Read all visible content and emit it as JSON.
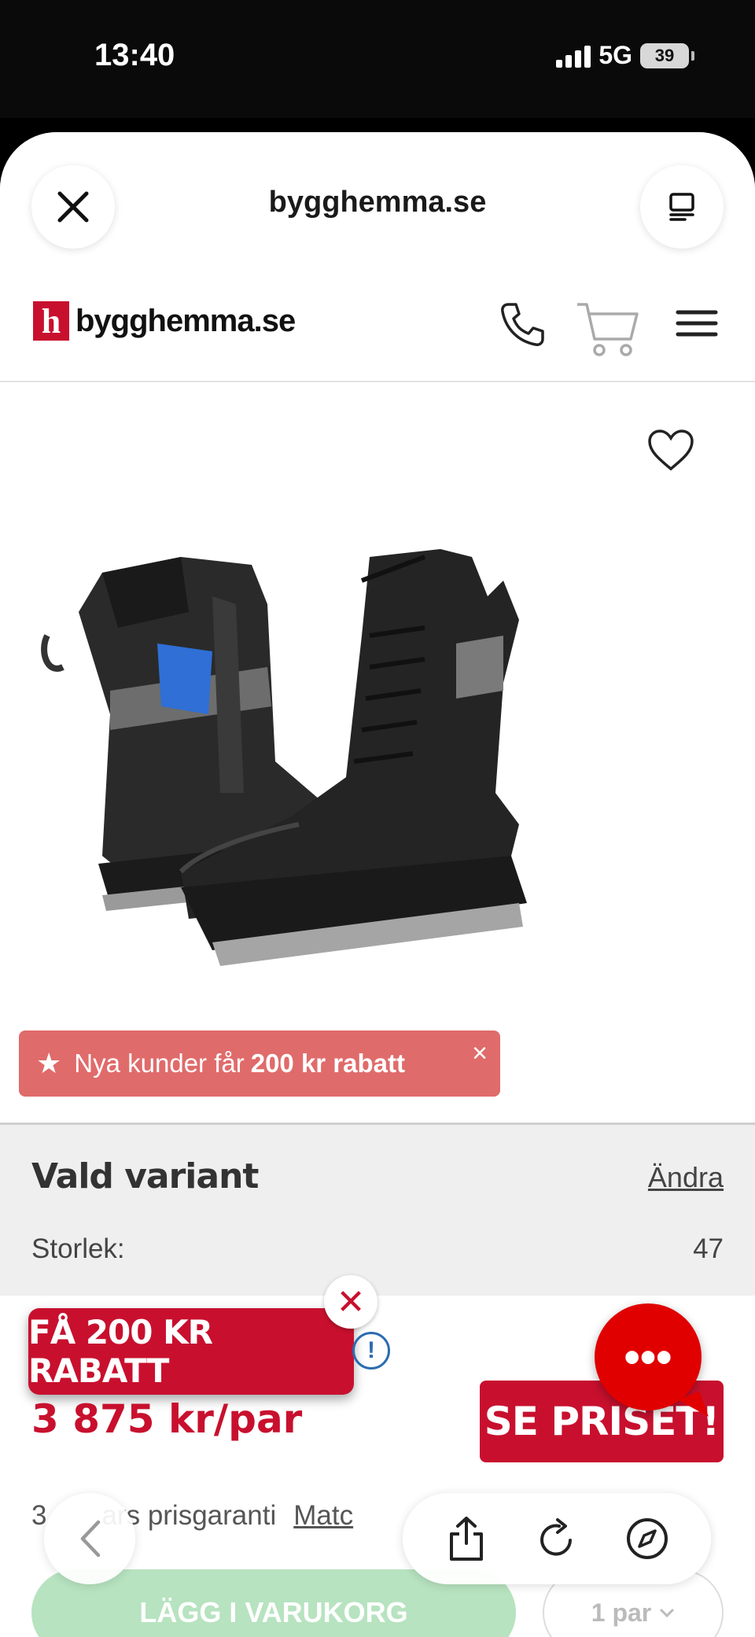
{
  "status_bar": {
    "time": "13:40",
    "network": "5G",
    "battery": "39"
  },
  "sheet": {
    "url": "bygghemma.se",
    "close_icon": "close-icon",
    "reader_icon": "reader-mode-icon"
  },
  "site_nav": {
    "logo_letter": "h",
    "logo_text": "bygghemma.se",
    "icons": [
      "phone-icon",
      "cart-icon",
      "menu-icon"
    ]
  },
  "product": {
    "favorite_icon": "heart-icon",
    "promo_banner": {
      "text": "Nya kunder får",
      "bold": "200 kr rabatt",
      "close": "×"
    }
  },
  "variant": {
    "title": "Vald variant",
    "change_label": "Ändra",
    "size_label": "Storlek:",
    "size_value": "47"
  },
  "pricing": {
    "rabatt_button": "FÅ 200 KR RABATT",
    "rabatt_close": "✕",
    "info_icon": "!",
    "price": "3 875 kr/par",
    "see_price_button": "SE PRISET!",
    "chat_button": "•••",
    "guarantee_text": "3",
    "guarantee_rest": "ars prisgaranti",
    "match_link": "Matc"
  },
  "cart": {
    "add_button": "LÄGG I VARUKORG",
    "quantity": "1 par"
  },
  "colors": {
    "brand_red": "#c8102e",
    "promo_banner": "#e06b6b",
    "add_to_cart_disabled": "#b7e3c0"
  }
}
